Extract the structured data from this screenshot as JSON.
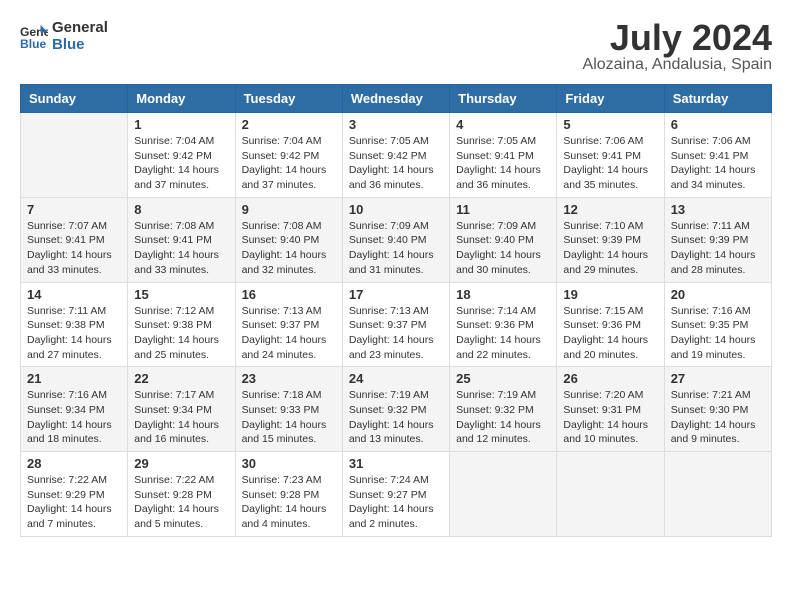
{
  "header": {
    "logo_line1": "General",
    "logo_line2": "Blue",
    "month_year": "July 2024",
    "location": "Alozaina, Andalusia, Spain"
  },
  "days_of_week": [
    "Sunday",
    "Monday",
    "Tuesday",
    "Wednesday",
    "Thursday",
    "Friday",
    "Saturday"
  ],
  "weeks": [
    [
      {
        "day": "",
        "empty": true
      },
      {
        "day": "1",
        "sunrise": "7:04 AM",
        "sunset": "9:42 PM",
        "daylight": "14 hours and 37 minutes."
      },
      {
        "day": "2",
        "sunrise": "7:04 AM",
        "sunset": "9:42 PM",
        "daylight": "14 hours and 37 minutes."
      },
      {
        "day": "3",
        "sunrise": "7:05 AM",
        "sunset": "9:42 PM",
        "daylight": "14 hours and 36 minutes."
      },
      {
        "day": "4",
        "sunrise": "7:05 AM",
        "sunset": "9:41 PM",
        "daylight": "14 hours and 36 minutes."
      },
      {
        "day": "5",
        "sunrise": "7:06 AM",
        "sunset": "9:41 PM",
        "daylight": "14 hours and 35 minutes."
      },
      {
        "day": "6",
        "sunrise": "7:06 AM",
        "sunset": "9:41 PM",
        "daylight": "14 hours and 34 minutes."
      }
    ],
    [
      {
        "day": "7",
        "sunrise": "7:07 AM",
        "sunset": "9:41 PM",
        "daylight": "14 hours and 33 minutes."
      },
      {
        "day": "8",
        "sunrise": "7:08 AM",
        "sunset": "9:41 PM",
        "daylight": "14 hours and 33 minutes."
      },
      {
        "day": "9",
        "sunrise": "7:08 AM",
        "sunset": "9:40 PM",
        "daylight": "14 hours and 32 minutes."
      },
      {
        "day": "10",
        "sunrise": "7:09 AM",
        "sunset": "9:40 PM",
        "daylight": "14 hours and 31 minutes."
      },
      {
        "day": "11",
        "sunrise": "7:09 AM",
        "sunset": "9:40 PM",
        "daylight": "14 hours and 30 minutes."
      },
      {
        "day": "12",
        "sunrise": "7:10 AM",
        "sunset": "9:39 PM",
        "daylight": "14 hours and 29 minutes."
      },
      {
        "day": "13",
        "sunrise": "7:11 AM",
        "sunset": "9:39 PM",
        "daylight": "14 hours and 28 minutes."
      }
    ],
    [
      {
        "day": "14",
        "sunrise": "7:11 AM",
        "sunset": "9:38 PM",
        "daylight": "14 hours and 27 minutes."
      },
      {
        "day": "15",
        "sunrise": "7:12 AM",
        "sunset": "9:38 PM",
        "daylight": "14 hours and 25 minutes."
      },
      {
        "day": "16",
        "sunrise": "7:13 AM",
        "sunset": "9:37 PM",
        "daylight": "14 hours and 24 minutes."
      },
      {
        "day": "17",
        "sunrise": "7:13 AM",
        "sunset": "9:37 PM",
        "daylight": "14 hours and 23 minutes."
      },
      {
        "day": "18",
        "sunrise": "7:14 AM",
        "sunset": "9:36 PM",
        "daylight": "14 hours and 22 minutes."
      },
      {
        "day": "19",
        "sunrise": "7:15 AM",
        "sunset": "9:36 PM",
        "daylight": "14 hours and 20 minutes."
      },
      {
        "day": "20",
        "sunrise": "7:16 AM",
        "sunset": "9:35 PM",
        "daylight": "14 hours and 19 minutes."
      }
    ],
    [
      {
        "day": "21",
        "sunrise": "7:16 AM",
        "sunset": "9:34 PM",
        "daylight": "14 hours and 18 minutes."
      },
      {
        "day": "22",
        "sunrise": "7:17 AM",
        "sunset": "9:34 PM",
        "daylight": "14 hours and 16 minutes."
      },
      {
        "day": "23",
        "sunrise": "7:18 AM",
        "sunset": "9:33 PM",
        "daylight": "14 hours and 15 minutes."
      },
      {
        "day": "24",
        "sunrise": "7:19 AM",
        "sunset": "9:32 PM",
        "daylight": "14 hours and 13 minutes."
      },
      {
        "day": "25",
        "sunrise": "7:19 AM",
        "sunset": "9:32 PM",
        "daylight": "14 hours and 12 minutes."
      },
      {
        "day": "26",
        "sunrise": "7:20 AM",
        "sunset": "9:31 PM",
        "daylight": "14 hours and 10 minutes."
      },
      {
        "day": "27",
        "sunrise": "7:21 AM",
        "sunset": "9:30 PM",
        "daylight": "14 hours and 9 minutes."
      }
    ],
    [
      {
        "day": "28",
        "sunrise": "7:22 AM",
        "sunset": "9:29 PM",
        "daylight": "14 hours and 7 minutes."
      },
      {
        "day": "29",
        "sunrise": "7:22 AM",
        "sunset": "9:28 PM",
        "daylight": "14 hours and 5 minutes."
      },
      {
        "day": "30",
        "sunrise": "7:23 AM",
        "sunset": "9:28 PM",
        "daylight": "14 hours and 4 minutes."
      },
      {
        "day": "31",
        "sunrise": "7:24 AM",
        "sunset": "9:27 PM",
        "daylight": "14 hours and 2 minutes."
      },
      {
        "day": "",
        "empty": true
      },
      {
        "day": "",
        "empty": true
      },
      {
        "day": "",
        "empty": true
      }
    ]
  ]
}
